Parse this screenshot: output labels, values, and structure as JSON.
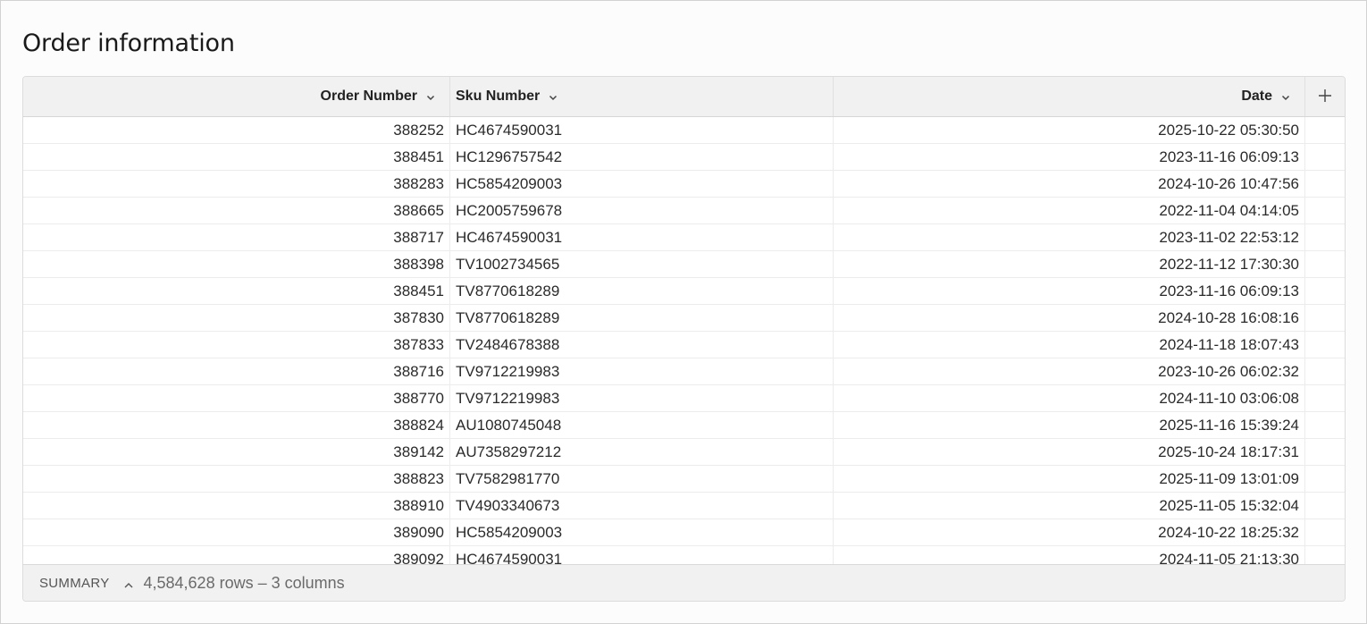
{
  "page": {
    "title": "Order information"
  },
  "table": {
    "columns": [
      {
        "label": "Order Number",
        "align": "right"
      },
      {
        "label": "Sku Number",
        "align": "left"
      },
      {
        "label": "Date",
        "align": "right"
      }
    ],
    "add_column_icon": "plus-icon",
    "sort_icon": "chevron-down-icon",
    "rows": [
      {
        "order": "388252",
        "sku": "HC4674590031",
        "date": "2025-10-22 05:30:50"
      },
      {
        "order": "388451",
        "sku": "HC1296757542",
        "date": "2023-11-16 06:09:13"
      },
      {
        "order": "388283",
        "sku": "HC5854209003",
        "date": "2024-10-26 10:47:56"
      },
      {
        "order": "388665",
        "sku": "HC2005759678",
        "date": "2022-11-04 04:14:05"
      },
      {
        "order": "388717",
        "sku": "HC4674590031",
        "date": "2023-11-02 22:53:12"
      },
      {
        "order": "388398",
        "sku": "TV1002734565",
        "date": "2022-11-12 17:30:30"
      },
      {
        "order": "388451",
        "sku": "TV8770618289",
        "date": "2023-11-16 06:09:13"
      },
      {
        "order": "387830",
        "sku": "TV8770618289",
        "date": "2024-10-28 16:08:16"
      },
      {
        "order": "387833",
        "sku": "TV2484678388",
        "date": "2024-11-18 18:07:43"
      },
      {
        "order": "388716",
        "sku": "TV9712219983",
        "date": "2023-10-26 06:02:32"
      },
      {
        "order": "388770",
        "sku": "TV9712219983",
        "date": "2024-11-10 03:06:08"
      },
      {
        "order": "388824",
        "sku": "AU1080745048",
        "date": "2025-11-16 15:39:24"
      },
      {
        "order": "389142",
        "sku": "AU7358297212",
        "date": "2025-10-24 18:17:31"
      },
      {
        "order": "388823",
        "sku": "TV7582981770",
        "date": "2025-11-09 13:01:09"
      },
      {
        "order": "388910",
        "sku": "TV4903340673",
        "date": "2025-11-05 15:32:04"
      },
      {
        "order": "389090",
        "sku": "HC5854209003",
        "date": "2024-10-22 18:25:32"
      },
      {
        "order": "389092",
        "sku": "HC4674590031",
        "date": "2024-11-05 21:13:30"
      }
    ]
  },
  "summary": {
    "label": "SUMMARY",
    "caret_icon": "chevron-up-icon",
    "info": "4,584,628 rows – 3 columns"
  }
}
